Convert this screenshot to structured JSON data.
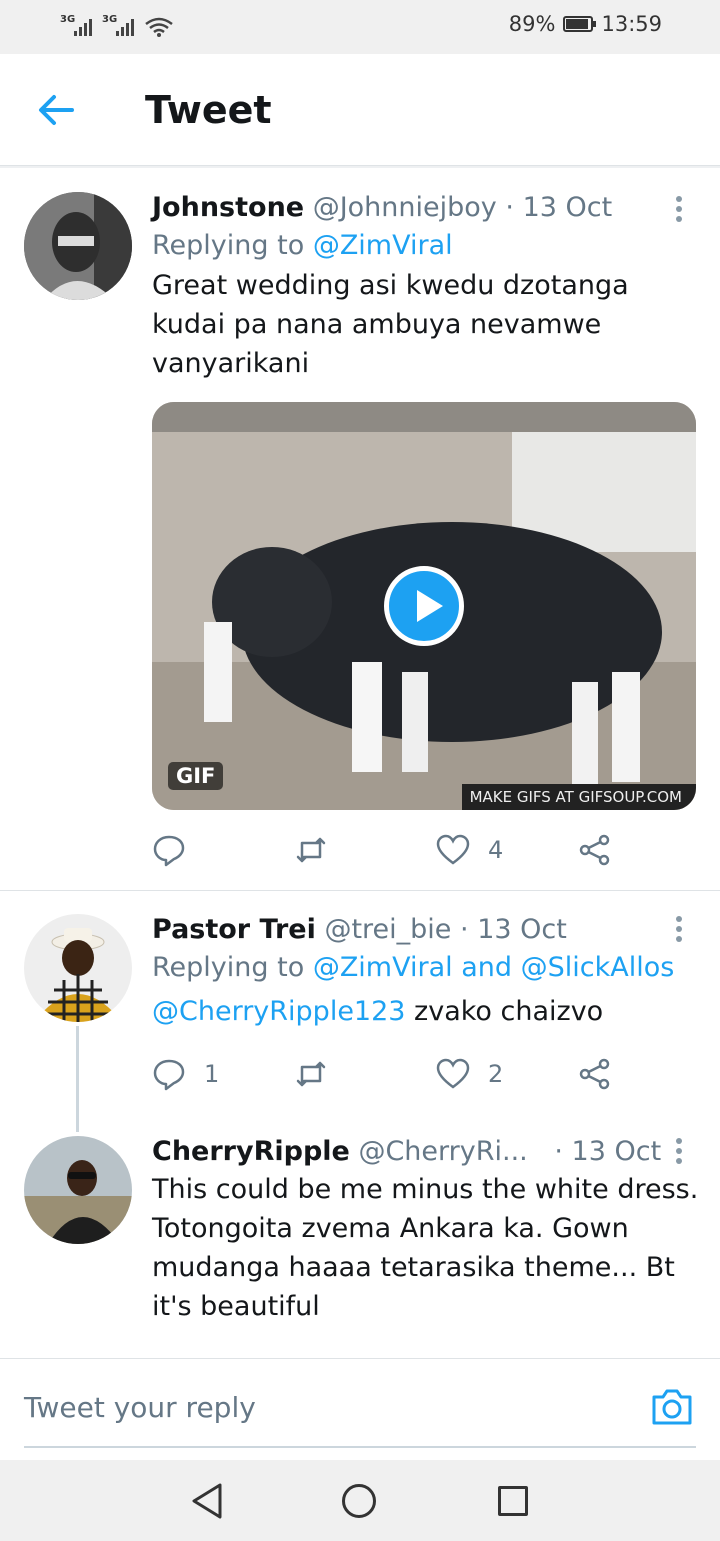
{
  "status_bar": {
    "signal_1": "3G",
    "signal_2": "3G",
    "battery": "89%",
    "battery_level": 0.89,
    "time": "13:59"
  },
  "header": {
    "title": "Tweet"
  },
  "tweets": [
    {
      "name": "Johnstone",
      "handle": "@Johnniejboy",
      "date": "13 Oct",
      "replying_prefix": "Replying to",
      "replying_to": "@ZimViral",
      "text": "Great wedding asi kwedu dzotanga kudai pa nana ambuya nevamwe vanyarikani",
      "media": {
        "badge": "GIF",
        "watermark": "MAKE GIFS AT GIFSOUP.COM"
      },
      "reply_count": "",
      "retweet_count": "",
      "like_count": "4"
    },
    {
      "name": "Pastor Trei",
      "handle": "@trei_bie",
      "date": "13 Oct",
      "replying_prefix": "Replying to",
      "replying_to": "@ZimViral and @SlickAllos",
      "mention": "@CherryRipple123",
      "text": " zvako chaizvo",
      "reply_count": "1",
      "retweet_count": "",
      "like_count": "2"
    },
    {
      "name": "CherryRipple",
      "handle": "@CherryRi...",
      "date": "13 Oct",
      "text": "This could be me minus the white dress. Totongoita zvema Ankara ka. Gown mudanga haaaa tetarasika theme... Bt it's beautiful"
    }
  ],
  "composer": {
    "placeholder": "Tweet your reply"
  },
  "colors": {
    "accent": "#1da1f2",
    "secondary_text": "#657786"
  }
}
